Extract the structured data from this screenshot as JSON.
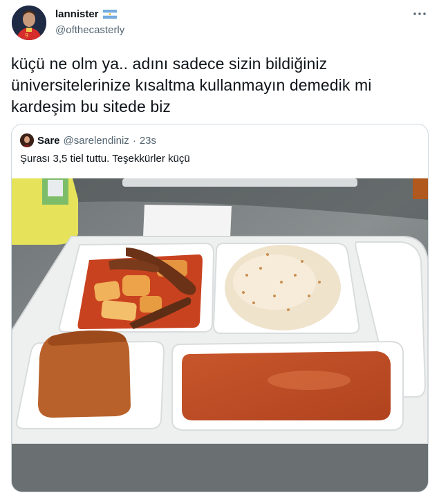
{
  "author": {
    "display_name": "lannister",
    "handle": "@ofthecasterly",
    "flag_icon": "argentina-flag-icon"
  },
  "tweet": {
    "lines": [
      "küçü ne olm ya.. adını sadece sizin bildiğiniz",
      "üniversitelerinize kısaltma kullanmayın demedik mi",
      "kardeşim bu sitede biz"
    ]
  },
  "quoted": {
    "display_name": "Sare",
    "handle": "@sarelendiniz",
    "separator": "·",
    "time": "23s",
    "text": "Şurası 3,5 tiel tuttu. Teşekkürler küçü",
    "media_description_icon": "food-tray-photo"
  },
  "colors": {
    "text_primary": "#0f1419",
    "text_secondary": "#536471",
    "border": "#cfd9de"
  }
}
